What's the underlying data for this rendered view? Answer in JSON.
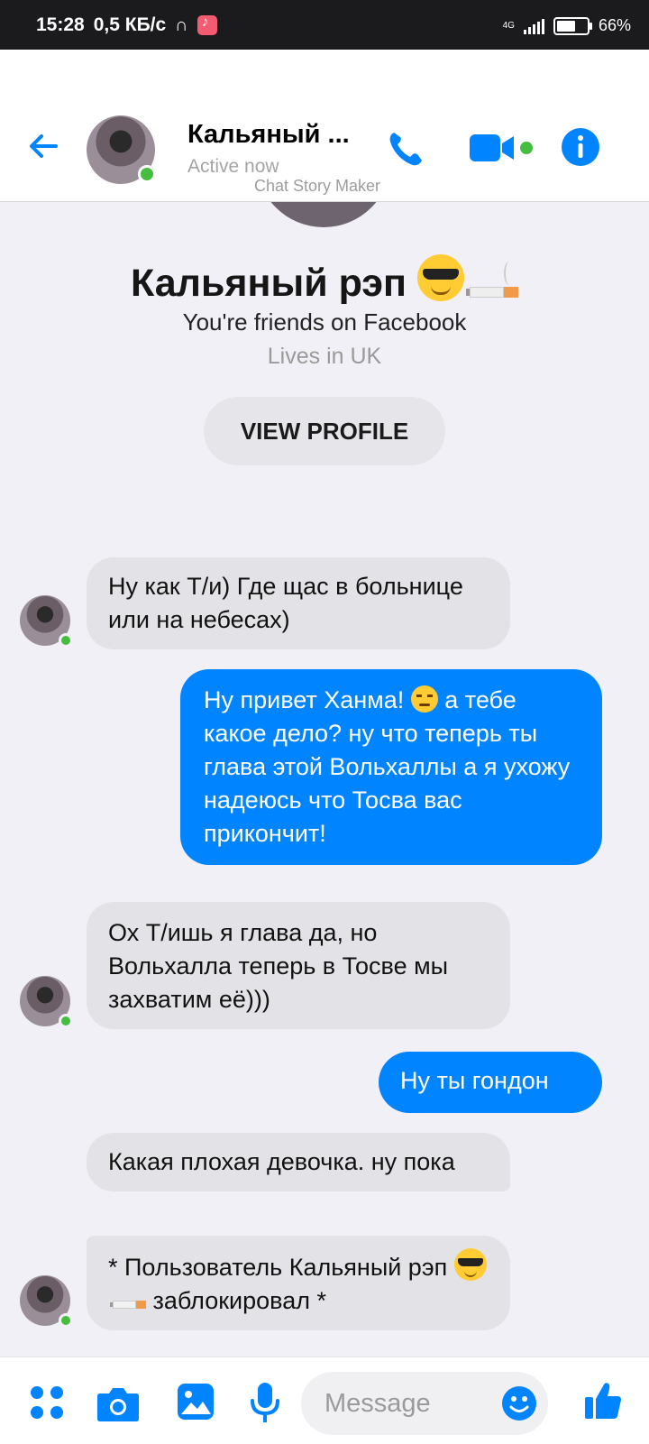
{
  "status_bar": {
    "time": "15:28",
    "speed": "0,5 КБ/с",
    "network": "4G",
    "battery": "66%",
    "battery_level": 0.66
  },
  "header": {
    "contact_name": "Кальяный ...",
    "status": "Active now",
    "watermark": "Chat Story Maker",
    "accent_color": "#0084ff",
    "online_color": "#45bd3e"
  },
  "profile": {
    "name": "Кальяный рэп",
    "friends_text": "You're friends on Facebook",
    "lives_text": "Lives in UK",
    "view_profile_label": "VIEW PROFILE"
  },
  "messages": [
    {
      "side": "in",
      "text": "Ну как Т/и) Где щас в больнице или на небесах)"
    },
    {
      "side": "out",
      "text_before": "Ну привет Ханма! ",
      "emoji": "unamused-face-icon",
      "text_after": " а тебе какое дело? ну что теперь ты глава этой Вольхаллы а я ухожу надеюсь что Тосва вас прикончит!"
    },
    {
      "side": "in",
      "text": "Ох Т/ишь я глава да, но Вольхалла теперь в Тосве мы захватим её)))"
    },
    {
      "side": "out",
      "text": "Ну ты гондон"
    },
    {
      "side": "in",
      "text": "Какая плохая девочка. ну пока"
    },
    {
      "side": "in",
      "text_before": "* Пользователь Кальяный рэп ",
      "emoji": "sunglasses-face-icon cigarette-icon",
      "text_after": " заблокировал *"
    }
  ],
  "composer": {
    "placeholder": "Message",
    "icons": [
      "menu-dots-icon",
      "camera-icon",
      "gallery-icon",
      "microphone-icon",
      "emoji-icon",
      "thumbs-up-icon"
    ]
  }
}
